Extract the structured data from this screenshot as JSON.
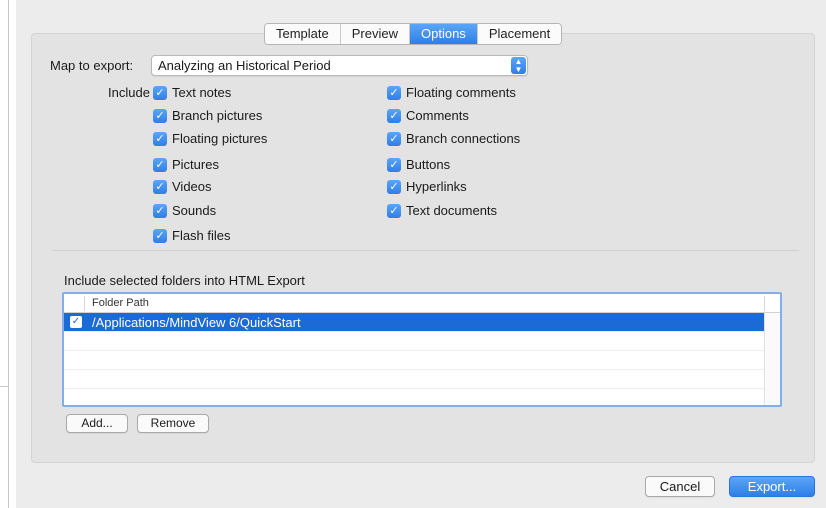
{
  "tabs": [
    {
      "label": "Template",
      "active": false
    },
    {
      "label": "Preview",
      "active": false
    },
    {
      "label": "Options",
      "active": true
    },
    {
      "label": "Placement",
      "active": false
    }
  ],
  "map_to_export": {
    "label": "Map to export:",
    "selected": "Analyzing an Historical Period"
  },
  "include": {
    "label": "Include",
    "left_column": [
      {
        "label": "Text notes",
        "checked": true
      },
      {
        "label": "Branch pictures",
        "checked": true
      },
      {
        "label": "Floating pictures",
        "checked": true
      },
      {
        "label": "Pictures",
        "checked": true
      },
      {
        "label": "Videos",
        "checked": true
      },
      {
        "label": "Sounds",
        "checked": true
      },
      {
        "label": "Flash files",
        "checked": true
      }
    ],
    "right_column": [
      {
        "label": "Floating comments",
        "checked": true
      },
      {
        "label": "Comments",
        "checked": true
      },
      {
        "label": "Branch connections",
        "checked": true
      },
      {
        "label": "Buttons",
        "checked": true
      },
      {
        "label": "Hyperlinks",
        "checked": true
      },
      {
        "label": "Text documents",
        "checked": true
      }
    ]
  },
  "folders": {
    "label": "Include selected folders into HTML Export",
    "column_header": "Folder Path",
    "rows": [
      {
        "path": "/Applications/MindView 6/QuickStart",
        "checked": true,
        "selected": true
      }
    ]
  },
  "buttons": {
    "add": "Add...",
    "remove": "Remove",
    "cancel": "Cancel",
    "export": "Export..."
  },
  "colors": {
    "accent": "#2f7ee8",
    "selection": "#1c6ad6"
  }
}
